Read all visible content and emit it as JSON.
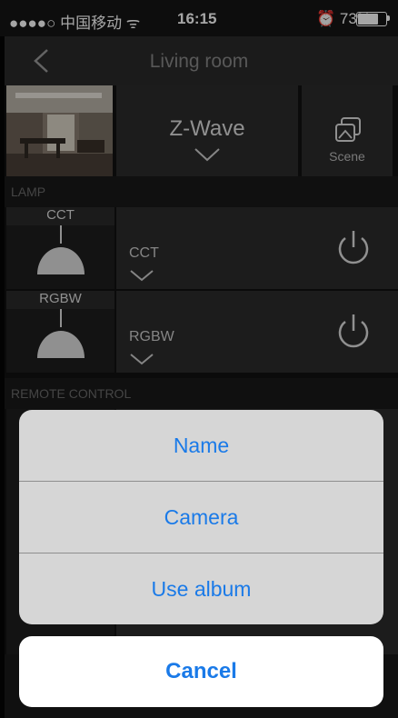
{
  "status_bar": {
    "carrier": "●●●●○ 中国移动 ᯤ",
    "time": "16:15",
    "battery_text": "⏰ 73%",
    "battery_level": 0.73
  },
  "nav": {
    "title": "Living room"
  },
  "header": {
    "protocol_label": "Z-Wave",
    "scene_label": "Scene"
  },
  "sections": {
    "lamp": "LAMP",
    "remote": "REMOTE CONTROL"
  },
  "devices": [
    {
      "tag": "CCT",
      "label": "CCT"
    },
    {
      "tag": "RGBW",
      "label": "RGBW"
    }
  ],
  "action_sheet": {
    "items": [
      "Name",
      "Camera",
      "Use album"
    ],
    "cancel": "Cancel"
  },
  "colors": {
    "accent": "#1a7ae8",
    "background": "#111111",
    "panel": "#2b2b2b"
  }
}
